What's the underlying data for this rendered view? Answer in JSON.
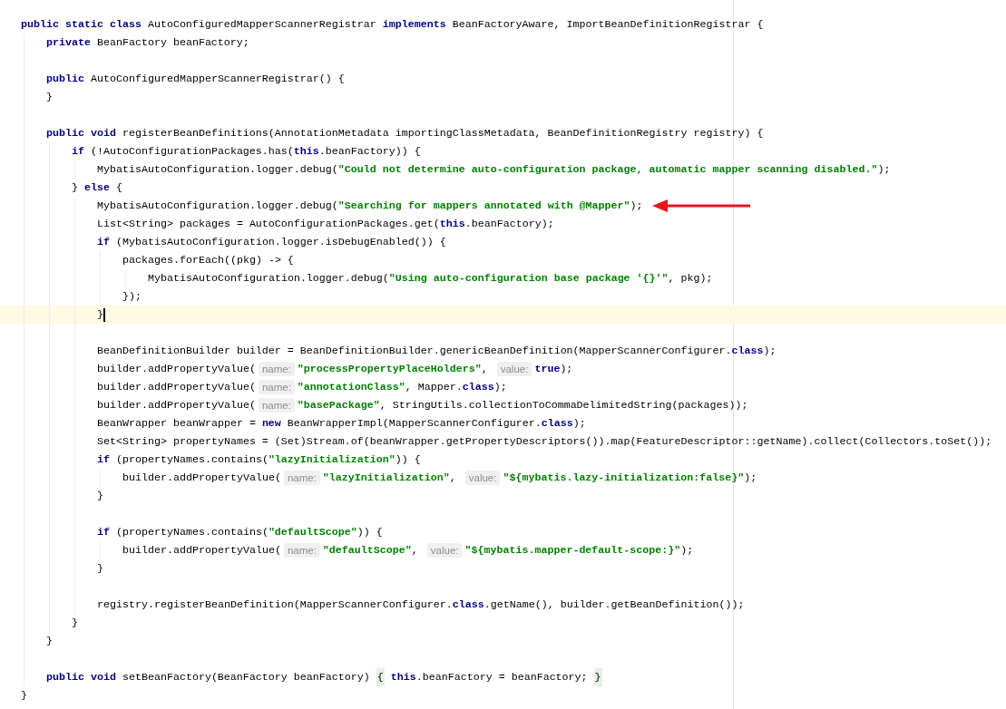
{
  "editor": {
    "lines": [
      {
        "tokens": [
          {
            "kind": "keyword",
            "text": "public static class"
          },
          " AutoConfiguredMapperScannerRegistrar ",
          {
            "kind": "keyword",
            "text": "implements"
          },
          " BeanFactoryAware, ImportBeanDefinitionRegistrar {"
        ],
        "children": [
          {
            "tokens": [
              {
                "kind": "keyword",
                "text": "private"
              },
              " BeanFactory beanFactory;"
            ]
          },
          {
            "blank_line_before": true,
            "tokens": [
              {
                "kind": "keyword",
                "text": "public"
              },
              " AutoConfiguredMapperScannerRegistrar() {"
            ]
          },
          {
            "tokens": [
              "}"
            ]
          },
          {
            "blank_line_before": true,
            "tokens": [
              {
                "kind": "keyword",
                "text": "public void"
              },
              " registerBeanDefinitions(AnnotationMetadata importingClassMetadata, BeanDefinitionRegistry registry) {"
            ],
            "children": [
              {
                "tokens": [
                  {
                    "kind": "keyword",
                    "text": "if"
                  },
                  " (!AutoConfigurationPackages.has(",
                  {
                    "kind": "keyword",
                    "text": "this"
                  },
                  ".beanFactory)) {"
                ],
                "children": [
                  {
                    "tokens": [
                      "MybatisAutoConfiguration.logger.debug(",
                      {
                        "kind": "string",
                        "text": "\"Could not determine auto-configuration package, automatic mapper scanning disabled.\""
                      },
                      ");"
                    ]
                  }
                ]
              },
              {
                "tokens": [
                  "} ",
                  {
                    "kind": "keyword",
                    "text": "else"
                  },
                  " {"
                ],
                "children": [
                  {
                    "marked": true,
                    "tokens": [
                      "MybatisAutoConfiguration.logger.debug(",
                      {
                        "kind": "string",
                        "text": "\"Searching for mappers annotated with @Mapper\""
                      },
                      ");"
                    ]
                  },
                  {
                    "tokens": [
                      "List<String> packages = AutoConfigurationPackages.get(",
                      {
                        "kind": "keyword",
                        "text": "this"
                      },
                      ".beanFactory);"
                    ]
                  },
                  {
                    "tokens": [
                      {
                        "kind": "keyword",
                        "text": "if"
                      },
                      " (MybatisAutoConfiguration.logger.isDebugEnabled()) {"
                    ],
                    "children": [
                      {
                        "tokens": [
                          "packages.forEach((pkg) -> {"
                        ],
                        "children": [
                          {
                            "tokens": [
                              "MybatisAutoConfiguration.logger.debug(",
                              {
                                "kind": "string",
                                "text": "\"Using auto-configuration base package '{}'\""
                              },
                              ", pkg);"
                            ]
                          }
                        ]
                      },
                      {
                        "tokens": [
                          "});"
                        ]
                      }
                    ]
                  },
                  {
                    "current": true,
                    "tokens": [
                      "}"
                    ]
                  },
                  {
                    "blank_line_before": true,
                    "tokens": [
                      "BeanDefinitionBuilder builder = BeanDefinitionBuilder.genericBeanDefinition(MapperScannerConfigurer.",
                      {
                        "kind": "keyword",
                        "text": "class"
                      },
                      ");"
                    ]
                  },
                  {
                    "tokens": [
                      "builder.addPropertyValue(",
                      {
                        "kind": "hint",
                        "text": "name:"
                      },
                      {
                        "kind": "string",
                        "text": "\"processPropertyPlaceHolders\""
                      },
                      ", ",
                      {
                        "kind": "hint",
                        "text": "value:"
                      },
                      {
                        "kind": "keyword",
                        "text": "true"
                      },
                      ");"
                    ]
                  },
                  {
                    "tokens": [
                      "builder.addPropertyValue(",
                      {
                        "kind": "hint",
                        "text": "name:"
                      },
                      {
                        "kind": "string",
                        "text": "\"annotationClass\""
                      },
                      ", Mapper.",
                      {
                        "kind": "keyword",
                        "text": "class"
                      },
                      ");"
                    ]
                  },
                  {
                    "tokens": [
                      "builder.addPropertyValue(",
                      {
                        "kind": "hint",
                        "text": "name:"
                      },
                      {
                        "kind": "string",
                        "text": "\"basePackage\""
                      },
                      ", StringUtils.collectionToCommaDelimitedString(packages));"
                    ]
                  },
                  {
                    "tokens": [
                      "BeanWrapper beanWrapper = ",
                      {
                        "kind": "keyword",
                        "text": "new"
                      },
                      " BeanWrapperImpl(MapperScannerConfigurer.",
                      {
                        "kind": "keyword",
                        "text": "class"
                      },
                      ");"
                    ]
                  },
                  {
                    "tokens": [
                      "Set<String> propertyNames = (Set)Stream.of(beanWrapper.getPropertyDescriptors()).map(FeatureDescriptor::getName).collect(Collectors.toSet());"
                    ]
                  },
                  {
                    "tokens": [
                      {
                        "kind": "keyword",
                        "text": "if"
                      },
                      " (propertyNames.contains(",
                      {
                        "kind": "string",
                        "text": "\"lazyInitialization\""
                      },
                      ")) {"
                    ],
                    "children": [
                      {
                        "tokens": [
                          "builder.addPropertyValue(",
                          {
                            "kind": "hint",
                            "text": "name:"
                          },
                          {
                            "kind": "string",
                            "text": "\"lazyInitialization\""
                          },
                          ", ",
                          {
                            "kind": "hint",
                            "text": "value:"
                          },
                          {
                            "kind": "string",
                            "text": "\"${mybatis.lazy-initialization:false}\""
                          },
                          ");"
                        ]
                      }
                    ]
                  },
                  {
                    "tokens": [
                      "}"
                    ]
                  },
                  {
                    "blank_line_before": true,
                    "tokens": [
                      {
                        "kind": "keyword",
                        "text": "if"
                      },
                      " (propertyNames.contains(",
                      {
                        "kind": "string",
                        "text": "\"defaultScope\""
                      },
                      ")) {"
                    ],
                    "children": [
                      {
                        "tokens": [
                          "builder.addPropertyValue(",
                          {
                            "kind": "hint",
                            "text": "name:"
                          },
                          {
                            "kind": "string",
                            "text": "\"defaultScope\""
                          },
                          ", ",
                          {
                            "kind": "hint",
                            "text": "value:"
                          },
                          {
                            "kind": "string",
                            "text": "\"${mybatis.mapper-default-scope:}\""
                          },
                          ");"
                        ]
                      }
                    ]
                  },
                  {
                    "tokens": [
                      "}"
                    ]
                  },
                  {
                    "blank_line_before": true,
                    "tokens": [
                      "registry.registerBeanDefinition(MapperScannerConfigurer.",
                      {
                        "kind": "keyword",
                        "text": "class"
                      },
                      ".getName(), builder.getBeanDefinition());"
                    ]
                  }
                ]
              },
              {
                "tokens": [
                  "}"
                ]
              }
            ]
          },
          {
            "tokens": [
              "}"
            ]
          },
          {
            "blank_line_before": true,
            "tokens": [
              {
                "kind": "keyword",
                "text": "public void"
              },
              " setBeanFactory(BeanFactory beanFactory) ",
              {
                "kind": "matched_brace",
                "text": "{"
              },
              {
                "kind": "keyword",
                "text": " this"
              },
              ".beanFactory = beanFactory; ",
              {
                "kind": "matched_brace",
                "text": "}"
              }
            ]
          }
        ]
      },
      {
        "tokens": [
          "}"
        ]
      }
    ]
  }
}
